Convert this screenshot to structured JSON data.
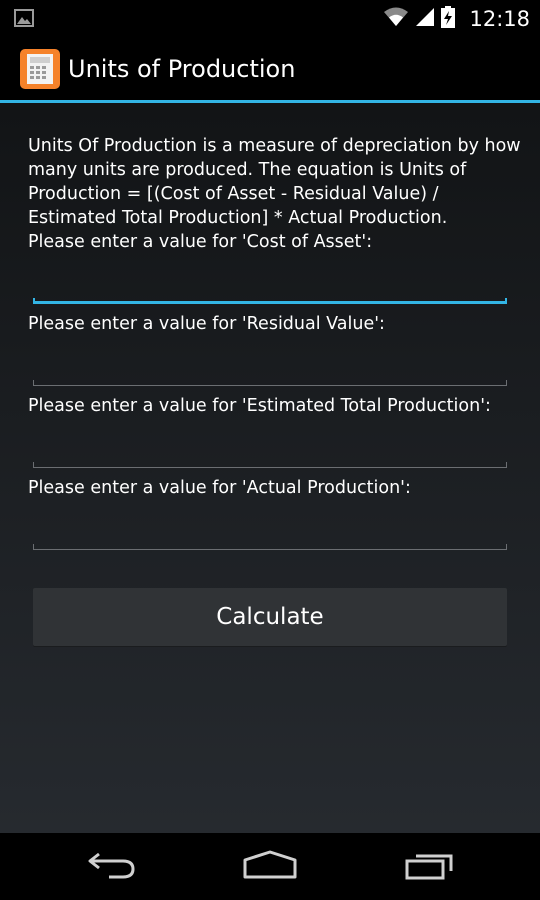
{
  "status_bar": {
    "time": "12:18",
    "icons": [
      "picture-notification-icon",
      "wifi-icon",
      "signal-icon",
      "battery-charging-icon"
    ]
  },
  "action_bar": {
    "title": "Units of Production",
    "app_icon": "calculator-icon"
  },
  "description": "Units Of Production is a measure of depreciation by how many units are produced. The equation is Units of Production = [(Cost of Asset - Residual Value) / Estimated Total Production] * Actual Production.",
  "fields": [
    {
      "label": "Please enter a value for 'Cost of  Asset':",
      "value": "",
      "focused": true
    },
    {
      "label": "Please enter a value for 'Residual Value':",
      "value": ""
    },
    {
      "label": "Please enter a value for 'Estimated Total Production':",
      "value": ""
    },
    {
      "label": "Please enter a value for 'Actual Production':",
      "value": ""
    }
  ],
  "calculate_label": "Calculate",
  "nav_bar": {
    "icons": [
      "back-icon",
      "home-icon",
      "recent-apps-icon"
    ]
  },
  "colors": {
    "accent": "#33b5e5",
    "app_icon": "#f5822a",
    "background_top": "#121416",
    "background_bottom": "#262a2f"
  }
}
